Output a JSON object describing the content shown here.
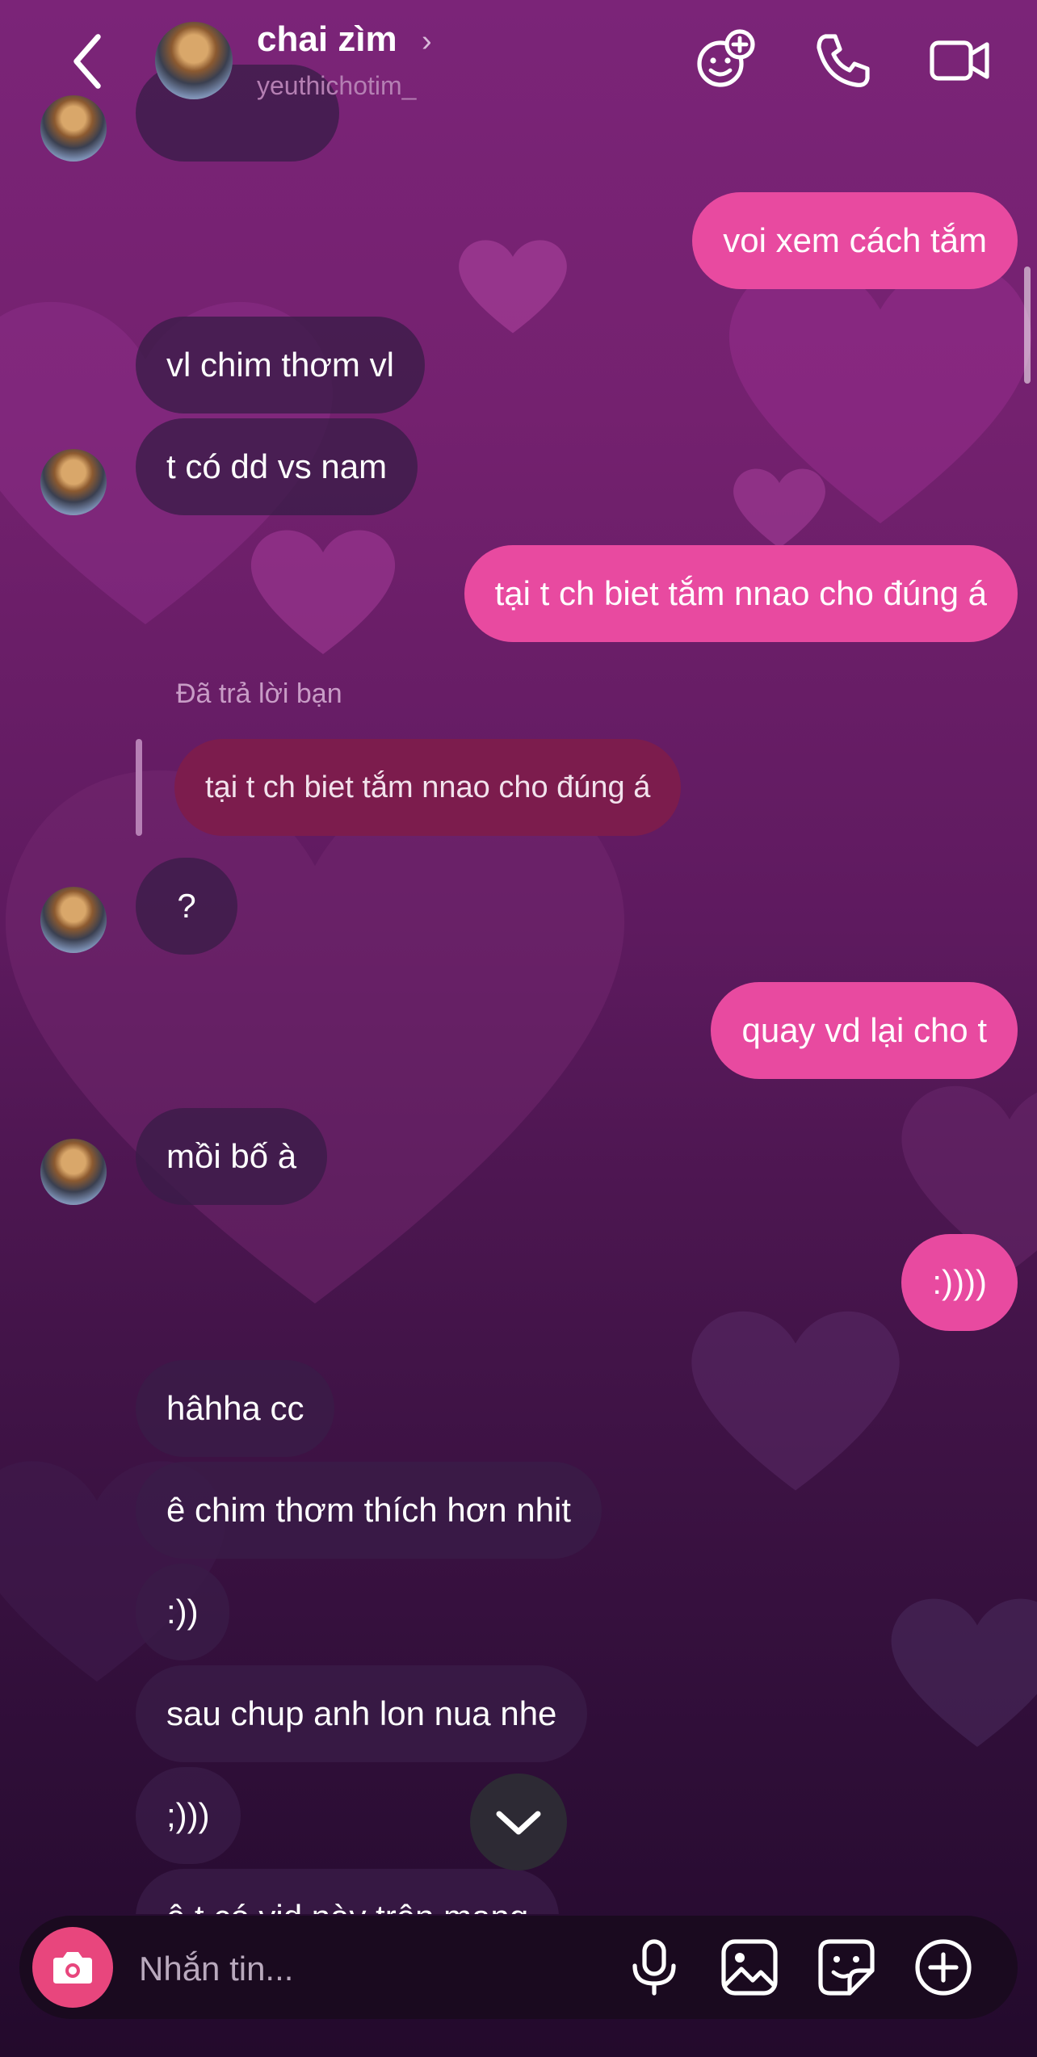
{
  "header": {
    "name": "chai zìm",
    "username": "yeuthichotim_",
    "icons": [
      "back-icon",
      "avatar",
      "chevron-right-icon",
      "effects-icon",
      "phone-icon",
      "video-icon"
    ]
  },
  "messages": {
    "m1": "voi xem cách tắm",
    "m2": "vl chim thơm vl",
    "m3": "t có dd vs nam",
    "m4": "tại t ch biet tắm nnao cho đúng á",
    "reply_note": "Đã trả lời bạn",
    "m5_quoted": "tại t ch biet tắm nnao cho đúng á",
    "m6": "?",
    "m7": "quay vd lại cho t",
    "m8": "mồi bố à",
    "m9": ":))))",
    "m10": "hâhha cc",
    "m11": "ê chim thơm thích hơn nhit",
    "m12": ":))",
    "m13": "sau chup anh lon nua nhe",
    "m14": ";)))",
    "m15": "ê t có vid này trên mạng"
  },
  "composer": {
    "placeholder": "Nhắn tin...",
    "icons": [
      "camera-icon",
      "microphone-icon",
      "image-icon",
      "sticker-icon",
      "plus-icon"
    ]
  },
  "colors": {
    "outgoing": "#e84aa0",
    "incoming": "#3a1c48",
    "camera": "#e8467d"
  }
}
